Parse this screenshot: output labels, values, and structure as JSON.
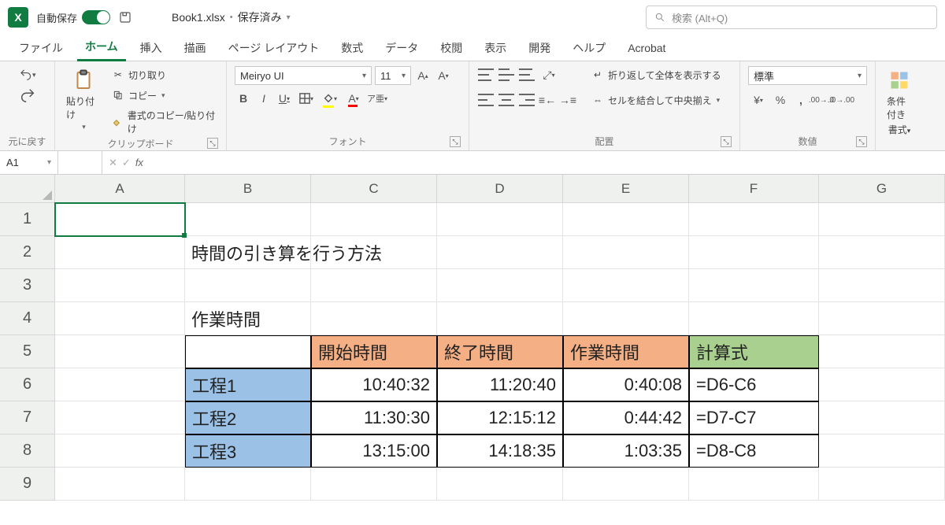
{
  "title": {
    "autosave_label": "自動保存",
    "filename": "Book1.xlsx",
    "saved_status": "保存済み"
  },
  "search": {
    "placeholder": "検索 (Alt+Q)"
  },
  "tabs": [
    "ファイル",
    "ホーム",
    "挿入",
    "描画",
    "ページ レイアウト",
    "数式",
    "データ",
    "校閲",
    "表示",
    "開発",
    "ヘルプ",
    "Acrobat"
  ],
  "ribbon": {
    "undo_group": "元に戻す",
    "clipboard": {
      "paste": "貼り付け",
      "cut": "切り取り",
      "copy": "コピー",
      "format_painter": "書式のコピー/貼り付け",
      "label": "クリップボード"
    },
    "font": {
      "name": "Meiryo UI",
      "size": "11",
      "label": "フォント"
    },
    "alignment": {
      "wrap": "折り返して全体を表示する",
      "merge": "セルを結合して中央揃え",
      "label": "配置"
    },
    "number": {
      "format": "標準",
      "label": "数値"
    },
    "cond": {
      "line1": "条件付き",
      "line2": "書式"
    }
  },
  "namebox": "A1",
  "columns": [
    "A",
    "B",
    "C",
    "D",
    "E",
    "F",
    "G"
  ],
  "rows": [
    "1",
    "2",
    "3",
    "4",
    "5",
    "6",
    "7",
    "8",
    "9"
  ],
  "cells": {
    "B2": "時間の引き算を行う方法",
    "B4": "作業時間",
    "C5": "開始時間",
    "D5": "終了時間",
    "E5": "作業時間",
    "F5": "計算式",
    "B6": "工程1",
    "C6": "10:40:32",
    "D6": "11:20:40",
    "E6": "0:40:08",
    "F6": "=D6-C6",
    "B7": "工程2",
    "C7": "11:30:30",
    "D7": "12:15:12",
    "E7": "0:44:42",
    "F7": "=D7-C7",
    "B8": "工程3",
    "C8": "13:15:00",
    "D8": "14:18:35",
    "E8": "1:03:35",
    "F8": "=D8-C8"
  }
}
